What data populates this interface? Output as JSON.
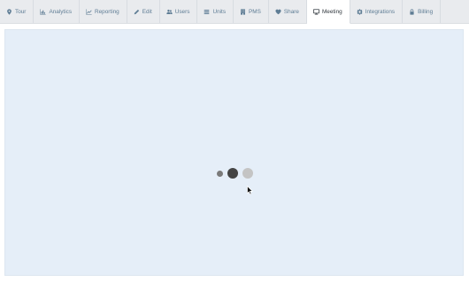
{
  "tabs": [
    {
      "label": "Tour",
      "icon": "map-marker-icon",
      "active": false
    },
    {
      "label": "Analytics",
      "icon": "bar-chart-icon",
      "active": false
    },
    {
      "label": "Reporting",
      "icon": "line-chart-icon",
      "active": false
    },
    {
      "label": "Edit",
      "icon": "pencil-icon",
      "active": false
    },
    {
      "label": "Users",
      "icon": "users-icon",
      "active": false
    },
    {
      "label": "Units",
      "icon": "list-icon",
      "active": false
    },
    {
      "label": "PMS",
      "icon": "building-icon",
      "active": false
    },
    {
      "label": "Share",
      "icon": "heart-icon",
      "active": false
    },
    {
      "label": "Meeting",
      "icon": "desktop-icon",
      "active": true
    },
    {
      "label": "Integrations",
      "icon": "gear-icon",
      "active": false
    },
    {
      "label": "Billing",
      "icon": "lock-icon",
      "active": false
    }
  ],
  "colors": {
    "tab_text": "#5f7d95",
    "active_tab_text": "#333a40",
    "panel_bg": "#e5eef8",
    "loader_dark": "#444444",
    "loader_mid": "#7a7a7a",
    "loader_light": "#c4c4c4"
  }
}
